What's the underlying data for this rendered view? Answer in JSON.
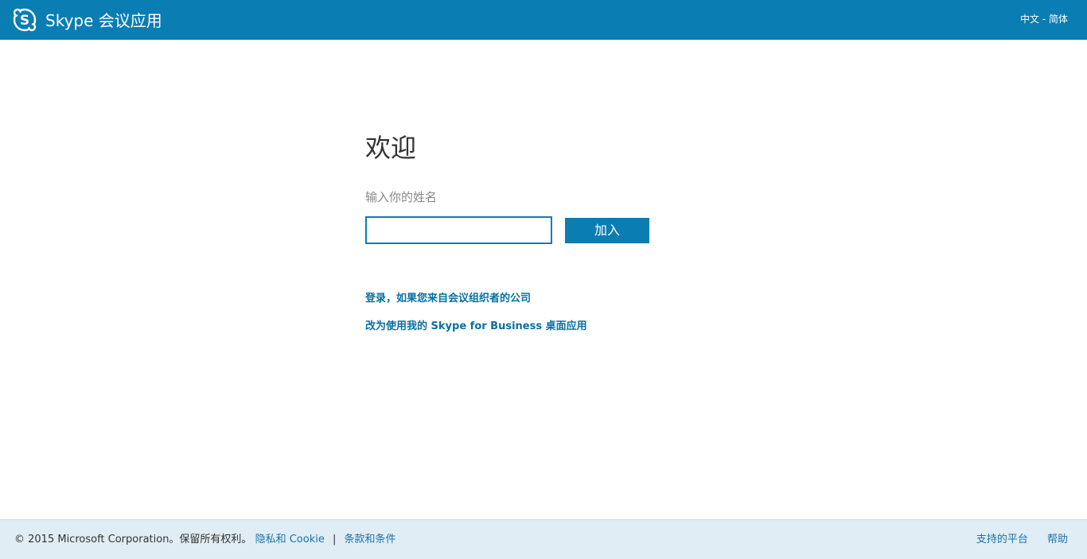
{
  "header": {
    "title": "Skype 会议应用",
    "language": "中文 - 简体"
  },
  "main": {
    "welcome": "欢迎",
    "name_label": "输入你的姓名",
    "name_value": "",
    "join_button": "加入",
    "link_signin": "登录，如果您来自会议组织者的公司",
    "link_desktop": "改为使用我的 Skype for Business 桌面应用"
  },
  "footer": {
    "copyright": "© 2015 Microsoft Corporation。保留所有权利。",
    "privacy": "隐私和 Cookie",
    "separator": "|",
    "terms": "条款和条件",
    "platforms": "支持的平台",
    "help": "帮助"
  },
  "colors": {
    "brand": "#0a7db3",
    "footer_bg": "#e1edf4",
    "link": "#0a6fa0"
  },
  "icons": {
    "logo": "skype-logo-icon"
  }
}
